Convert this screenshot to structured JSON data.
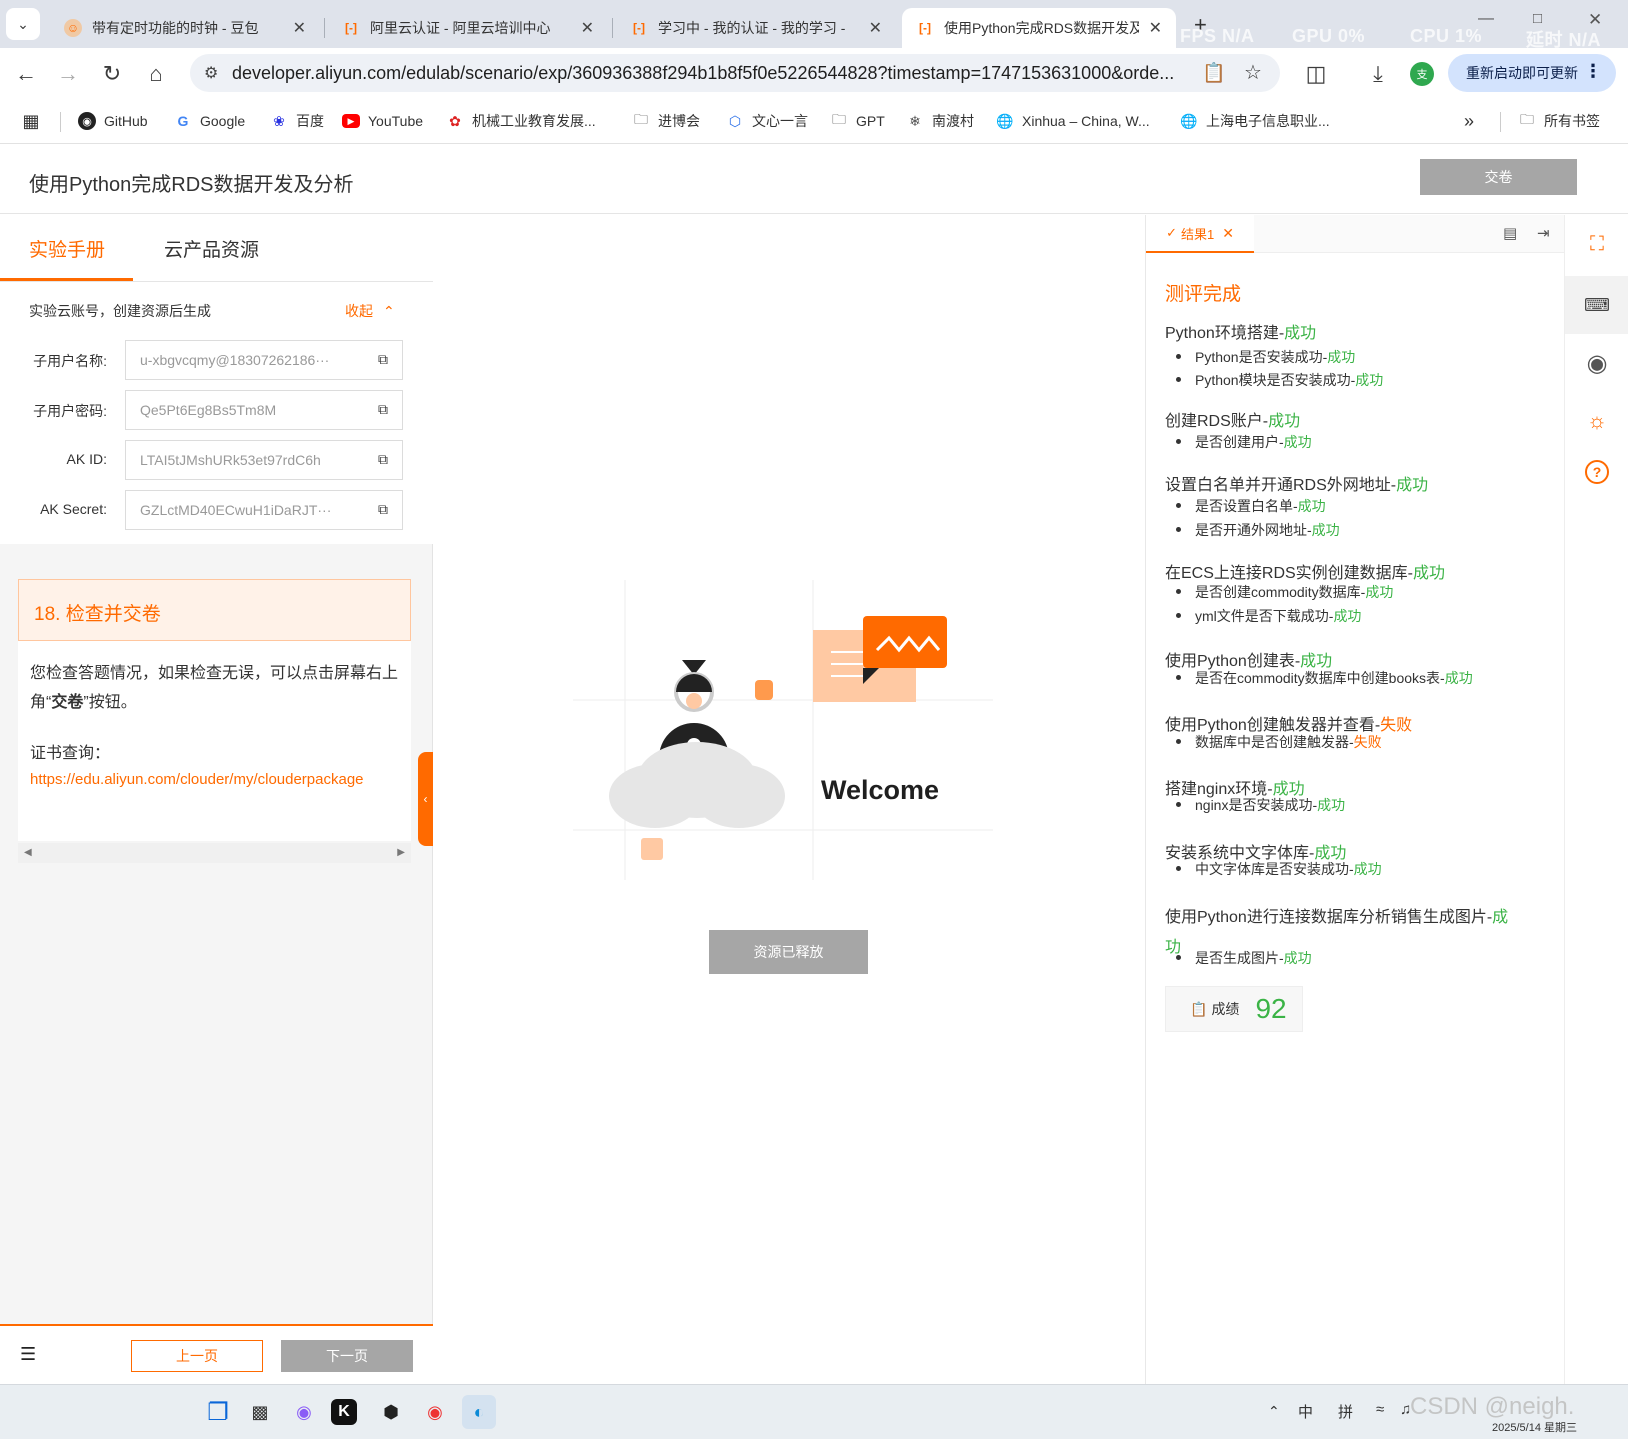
{
  "browser": {
    "tabs": [
      {
        "title": "带有定时功能的时钟 - 豆包",
        "active": false
      },
      {
        "title": "阿里云认证 - 阿里云培训中心",
        "active": false
      },
      {
        "title": "学习中 - 我的认证 - 我的学习 -",
        "active": false
      },
      {
        "title": "使用Python完成RDS数据开发及",
        "active": true
      }
    ],
    "new_tab": "+",
    "overlay": {
      "fps": "FPS N/A",
      "gpu": "GPU 0%",
      "cpu": "CPU 1%",
      "latency": "延时 N/A"
    },
    "url": "developer.aliyun.com/edulab/scenario/exp/360936388f294b1b8f5f0e5226544828?timestamp=1747153631000&orde...",
    "relaunch_label": "重新启动即可更新",
    "profile_initial": "支"
  },
  "bookmarks": [
    {
      "label": "GitHub",
      "icon": "github-icon"
    },
    {
      "label": "Google",
      "icon": "google-icon"
    },
    {
      "label": "百度",
      "icon": "baidu-icon"
    },
    {
      "label": "YouTube",
      "icon": "youtube-icon"
    },
    {
      "label": "机械工业教育发展...",
      "icon": "site-icon"
    },
    {
      "label": "进博会",
      "icon": "folder-icon"
    },
    {
      "label": "文心一言",
      "icon": "wenxin-icon"
    },
    {
      "label": "GPT",
      "icon": "folder-icon"
    },
    {
      "label": "南渡村",
      "icon": "site-icon"
    },
    {
      "label": "Xinhua – China, W...",
      "icon": "globe-icon"
    },
    {
      "label": "上海电子信息职业...",
      "icon": "globe-icon"
    }
  ],
  "bookmarks_all": "所有书签",
  "page": {
    "title": "使用Python完成RDS数据开发及分析",
    "submit_label": "交卷",
    "left_tabs": [
      "实验手册",
      "云产品资源"
    ],
    "account_note": "实验云账号，创建资源后生成",
    "collapse_label": "收起",
    "fields": [
      {
        "label": "子用户名称:",
        "value": "u-xbgvcqmy@18307262186···"
      },
      {
        "label": "子用户密码:",
        "value": "Qe5Pt6Eg8Bs5Tm8M"
      },
      {
        "label": "AK ID:",
        "value": "LTAI5tJMshURk53et97rdC6h"
      },
      {
        "label": "AK Secret:",
        "value": "GZLctMD40ECwuH1iDaRJT···"
      }
    ],
    "step_title": "18. 检查并交卷",
    "step_text_1": "您检查答题情况，如果检查无误，可以点击屏幕右上角“",
    "step_text_bold": "交卷",
    "step_text_2": "”按钮。",
    "cert_label": "证书查询：",
    "cert_link": "https://edu.aliyun.com/clouder/my/clouderpackage",
    "prev_label": "上一页",
    "next_label": "下一页",
    "welcome_text": "Welcome",
    "released_label": "资源已释放",
    "result_tab": "结果1",
    "result_title": "测评完成",
    "sections": [
      {
        "title": "Python环境搭建-",
        "status": "成功",
        "ok": true,
        "items": [
          {
            "text": "Python是否安装成功-",
            "status": "成功",
            "ok": true
          },
          {
            "text": "Python模块是否安装成功-",
            "status": "成功",
            "ok": true
          }
        ]
      },
      {
        "title": "创建RDS账户-",
        "status": "成功",
        "ok": true,
        "items": [
          {
            "text": "是否创建用户-",
            "status": "成功",
            "ok": true
          }
        ]
      },
      {
        "title": "设置白名单并开通RDS外网地址-",
        "status": "成功",
        "ok": true,
        "items": [
          {
            "text": "是否设置白名单-",
            "status": "成功",
            "ok": true
          },
          {
            "text": "是否开通外网地址-",
            "status": "成功",
            "ok": true
          }
        ]
      },
      {
        "title": "在ECS上连接RDS实例创建数据库-",
        "status": "成功",
        "ok": true,
        "items": [
          {
            "text": "是否创建commodity数据库-",
            "status": "成功",
            "ok": true
          },
          {
            "text": "yml文件是否下载成功-",
            "status": "成功",
            "ok": true
          }
        ]
      },
      {
        "title": "使用Python创建表-",
        "status": "成功",
        "ok": true,
        "items": [
          {
            "text": "是否在commodity数据库中创建books表-",
            "status": "成功",
            "ok": true
          }
        ]
      },
      {
        "title": "使用Python创建触发器并查看-",
        "status": "失败",
        "ok": false,
        "items": [
          {
            "text": "数据库中是否创建触发器-",
            "status": "失败",
            "ok": false
          }
        ]
      },
      {
        "title": "搭建nginx环境-",
        "status": "成功",
        "ok": true,
        "items": [
          {
            "text": "nginx是否安装成功-",
            "status": "成功",
            "ok": true
          }
        ]
      },
      {
        "title": "安装系统中文字体库-",
        "status": "成功",
        "ok": true,
        "items": [
          {
            "text": "中文字体库是否安装成功-",
            "status": "成功",
            "ok": true
          }
        ]
      },
      {
        "title": "使用Python进行连接数据库分析销售生成图片-",
        "status_a": "成",
        "status_b": "功",
        "ok": true,
        "items": [
          {
            "text": "是否生成图片-",
            "status": "成功",
            "ok": true
          }
        ]
      }
    ],
    "score_label": "成绩",
    "score_value": "92"
  },
  "taskbar": {
    "ime_1": "中",
    "ime_2": "拼",
    "date": "2025/5/14 星期三",
    "watermark": "CSDN @neigh."
  },
  "colors": {
    "accent": "#ff6a00",
    "success": "#3bb346",
    "fail": "#ff6a00",
    "disabled": "#a6a6a6"
  }
}
